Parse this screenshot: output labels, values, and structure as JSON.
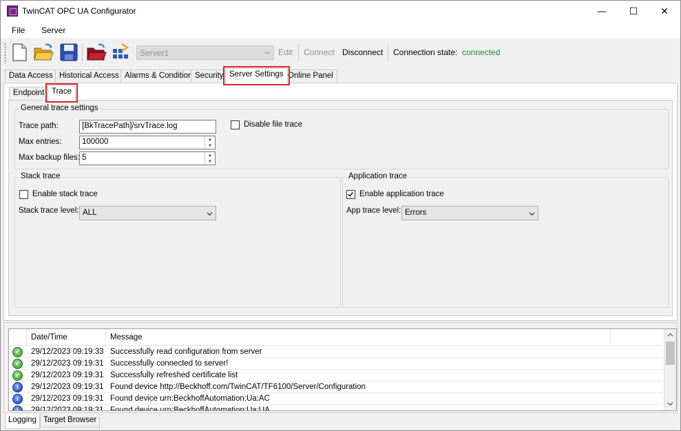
{
  "window": {
    "title": "TwinCAT OPC UA Configurator",
    "minimize": "—",
    "maximize": "☐",
    "close": "✕"
  },
  "menu": {
    "items": [
      "File",
      "Server"
    ]
  },
  "toolbar": {
    "server_combo": "Server1",
    "edit": "Edit",
    "connect": "Connect",
    "disconnect": "Disconnect",
    "connection_state_label": "Connection state:",
    "connection_state_value": "connected",
    "connection_state_color": "#1c8c1c",
    "icons": [
      "new-document-icon",
      "open-folder-icon",
      "save-disk-icon",
      "open-red-folder-icon",
      "network-import-icon"
    ]
  },
  "main_tabs": [
    "Data Access",
    "Historical Access",
    "Alarms & Conditions",
    "Security",
    "Server Settings",
    "Online Panel"
  ],
  "main_tab_active": "Server Settings",
  "sub_tabs": [
    "Endpoint",
    "Trace"
  ],
  "sub_tab_active": "Trace",
  "highlight_color": "#d9232e",
  "general": {
    "title": "General trace settings",
    "trace_path_label": "Trace path:",
    "trace_path_value": "[BkTracePath]/srvTrace.log",
    "disable_file_trace_label": "Disable file trace",
    "disable_file_trace_checked": false,
    "max_entries_label": "Max entries:",
    "max_entries_value": "100000",
    "max_backup_label": "Max backup files:",
    "max_backup_value": "5"
  },
  "stack": {
    "title": "Stack trace",
    "enable_label": "Enable stack trace",
    "enable_checked": false,
    "level_label": "Stack trace level:",
    "level_value": "ALL"
  },
  "app": {
    "title": "Application trace",
    "enable_label": "Enable application trace",
    "enable_checked": true,
    "level_label": "App trace level:",
    "level_value": "Errors"
  },
  "log": {
    "columns": [
      "Date/Time",
      "Message"
    ],
    "rows": [
      {
        "type": "ok",
        "time": "29/12/2023 09:19:33",
        "msg": "Successfully read configuration from server"
      },
      {
        "type": "ok",
        "time": "29/12/2023 09:19:31",
        "msg": "Successfully connected to server!"
      },
      {
        "type": "ok",
        "time": "29/12/2023 09:19:31",
        "msg": "Successfully refreshed certificate list"
      },
      {
        "type": "info",
        "time": "29/12/2023 09:19:31",
        "msg": "Found device http://Beckhoff.com/TwinCAT/TF6100/Server/Configuration"
      },
      {
        "type": "info",
        "time": "29/12/2023 09:19:31",
        "msg": "Found device urn:BeckhoffAutomation:Ua:AC"
      },
      {
        "type": "info",
        "time": "29/12/2023 09:19:31",
        "msg": "Found device urn:BeckhoffAutomation:Ua:UA"
      }
    ]
  },
  "bottom_tabs": [
    "Logging",
    "Target Browser"
  ],
  "bottom_tab_active": "Logging"
}
